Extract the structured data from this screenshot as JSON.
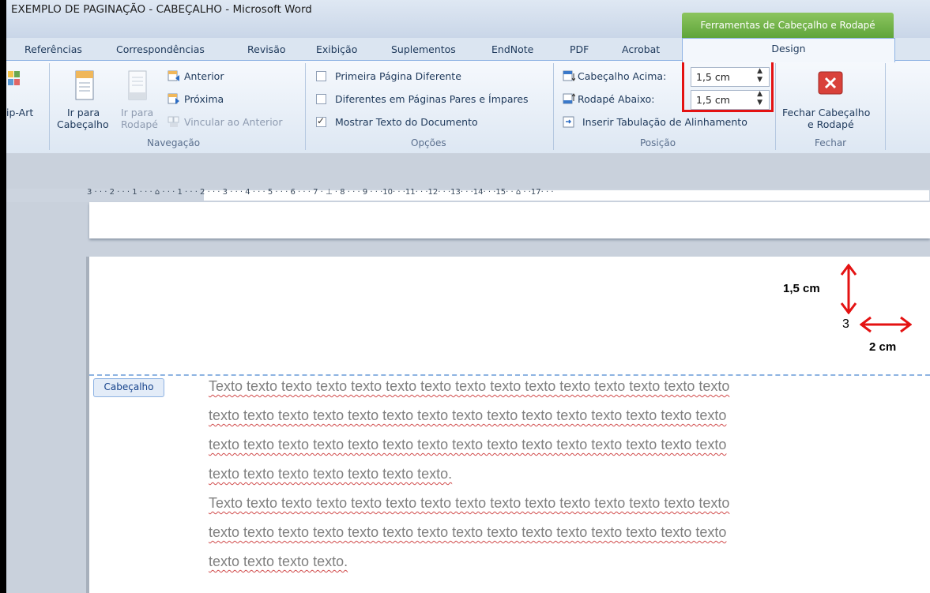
{
  "window": {
    "title": "EXEMPLO DE PAGINAÇÃO - CABEÇALHO  -  Microsoft Word",
    "contextual_tab": "Ferramentas de Cabeçalho e Rodapé"
  },
  "tabs": [
    "Referências",
    "Correspondências",
    "Revisão",
    "Exibição",
    "Suplementos",
    "EndNote",
    "PDF",
    "Acrobat"
  ],
  "active_tab": "Design",
  "ribbon": {
    "clipart_label": "ip-Art",
    "navegacao": {
      "goto_header_line1": "Ir para",
      "goto_header_line2": "Cabeçalho",
      "goto_footer_line1": "Ir para",
      "goto_footer_line2": "Rodapé",
      "previous": "Anterior",
      "next": "Próxima",
      "link_previous": "Vincular ao Anterior",
      "group_label": "Navegação"
    },
    "opcoes": {
      "different_first": "Primeira Página Diferente",
      "different_odd_even": "Diferentes em Páginas Pares e Ímpares",
      "show_document_text": "Mostrar Texto do Documento",
      "different_first_checked": false,
      "different_odd_even_checked": false,
      "show_document_text_checked": true,
      "group_label": "Opções"
    },
    "posicao": {
      "header_top_label": "Cabeçalho Acima:",
      "header_top_value": "1,5 cm",
      "footer_bottom_label": "Rodapé Abaixo:",
      "footer_bottom_value": "1,5 cm",
      "insert_tab": "Inserir Tabulação de Alinhamento",
      "group_label": "Posição"
    },
    "fechar": {
      "close_line1": "Fechar Cabeçalho",
      "close_line2": "e Rodapé",
      "group_label": "Fechar"
    }
  },
  "ruler": "3 · · · 2 · · · 1 · · · ⌂ · · · 1 · · · 2 · · · 3 · · · 4 · · · 5 · · · 6 · · · 7 · ⊥ · 8 · · · 9 · · ·10· · ·11· · ·12· · ·13· · ·14· · ·15· · ⌂ · ·17· · ·",
  "document": {
    "header_label": "Cabeçalho",
    "page_number": "3",
    "annotation_vertical": "1,5 cm",
    "annotation_horizontal": "2 cm",
    "lines": [
      "Texto texto texto texto texto texto texto texto texto texto texto texto texto texto texto",
      "texto texto texto texto texto texto texto texto texto texto texto texto texto texto texto",
      "texto texto texto texto texto texto texto texto texto texto texto texto texto texto texto",
      "texto texto texto texto texto texto texto.",
      "Texto texto texto texto texto texto texto texto texto texto texto texto texto texto texto",
      "texto texto texto texto texto texto texto texto texto texto texto texto texto texto texto",
      "texto texto texto texto."
    ]
  },
  "colors": {
    "highlight": "#e41212",
    "contextual": "#6bb043"
  }
}
